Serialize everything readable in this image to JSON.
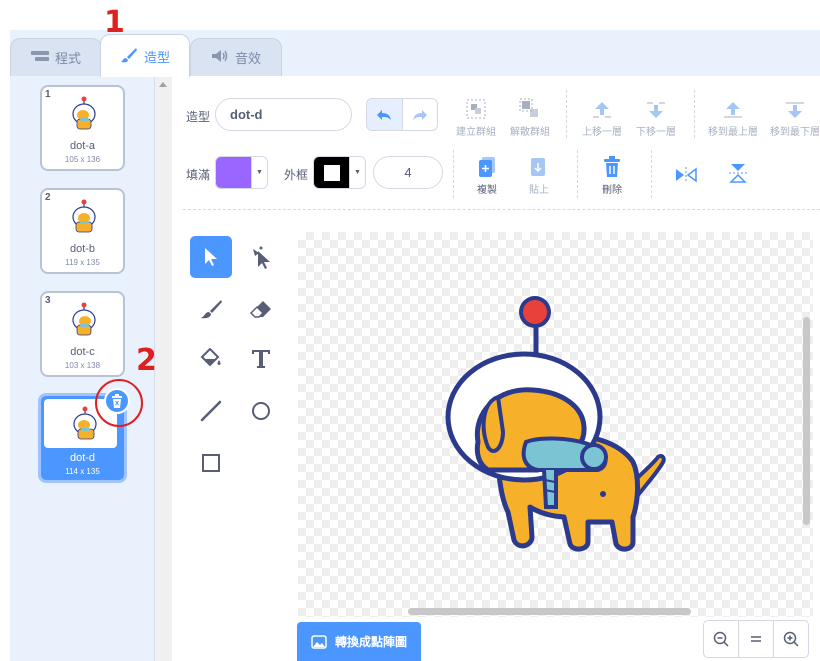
{
  "tabs": [
    {
      "label": "程式",
      "icon": "code-icon"
    },
    {
      "label": "造型",
      "icon": "paintbrush-icon",
      "active": true
    },
    {
      "label": "音效",
      "icon": "speaker-icon"
    }
  ],
  "costumes": [
    {
      "num": "1",
      "name": "dot-a",
      "size": "105 x 136"
    },
    {
      "num": "2",
      "name": "dot-b",
      "size": "119 x 135"
    },
    {
      "num": "3",
      "name": "dot-c",
      "size": "103 x 138"
    },
    {
      "num": "4",
      "name": "dot-d",
      "size": "114 x 135",
      "selected": true
    }
  ],
  "annotations": {
    "step1": "1",
    "step2": "2"
  },
  "toolbar": {
    "costume_label": "造型",
    "costume_name": "dot-d",
    "group": "建立群組",
    "ungroup": "解散群組",
    "forward": "上移一層",
    "backward": "下移一層",
    "front": "移到最上層",
    "back": "移到最下層",
    "fill_label": "填滿",
    "outline_label": "外框",
    "outline_width": "4",
    "copy": "複製",
    "paste": "貼上",
    "delete": "刪除"
  },
  "colors": {
    "fill": "#9966ff",
    "outline": "#000000",
    "accent": "#4c97ff"
  },
  "bottom": {
    "convert_bitmap": "轉換成點陣圖"
  }
}
